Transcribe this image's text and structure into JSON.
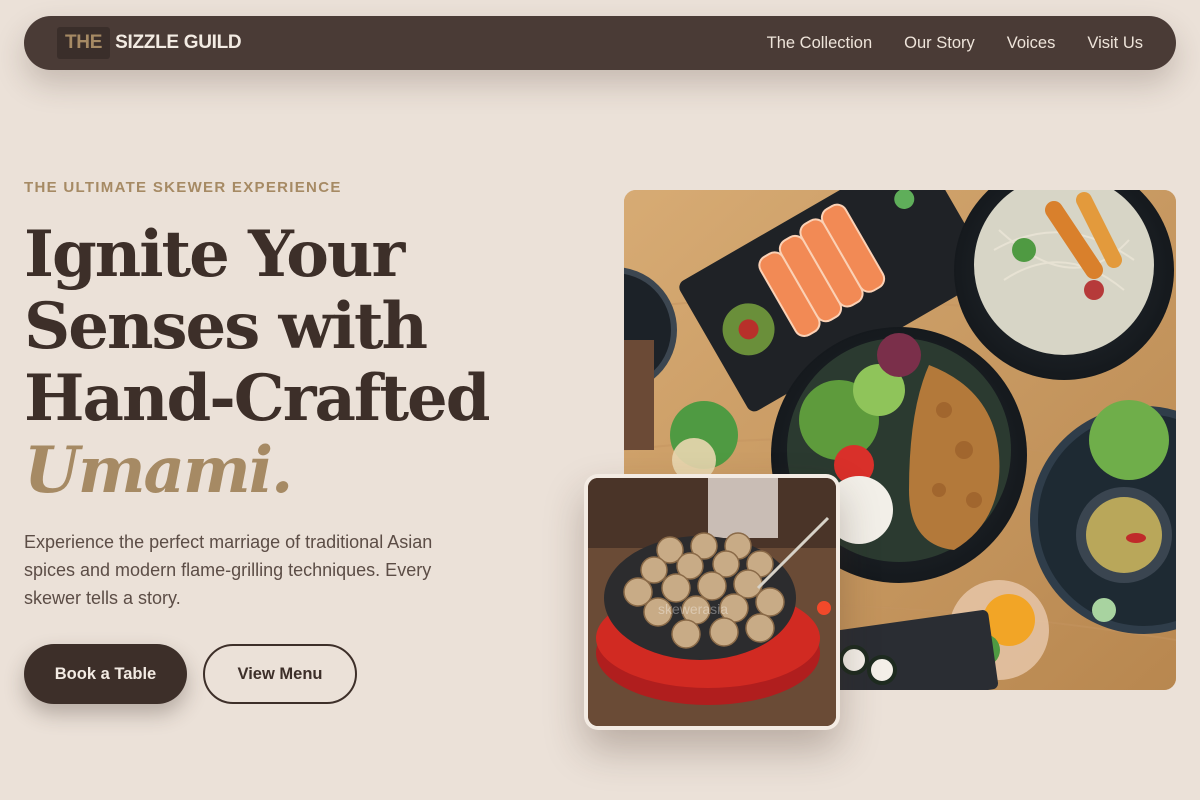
{
  "nav": {
    "brand_prefix": "THE",
    "brand_name": "SIZZLE GUILD",
    "links": [
      "The Collection",
      "Our Story",
      "Voices",
      "Visit Us"
    ]
  },
  "hero": {
    "eyebrow": "THE ULTIMATE SKEWER EXPERIENCE",
    "headline_lines": [
      "Ignite Your",
      "Senses with",
      "Hand-Crafted"
    ],
    "headline_accent": "Umami.",
    "description": "Experience the perfect marriage of traditional Asian spices and modern flame-grilling techniques. Every skewer tells a story.",
    "primary_button": "Book a Table",
    "secondary_button": "View Menu"
  },
  "images": {
    "main_alt": "Overhead view of sashimi, noodle salads and grilled chicken bowls",
    "inset_alt": "Takoyaki balls cooking in a red electric pan",
    "inset_watermark": "skewerasia"
  },
  "colors": {
    "background": "#ebe1d8",
    "nav": "#4a3b36",
    "primary": "#3d2f29",
    "accent": "#a68a64",
    "text_muted": "#5c4d46"
  }
}
